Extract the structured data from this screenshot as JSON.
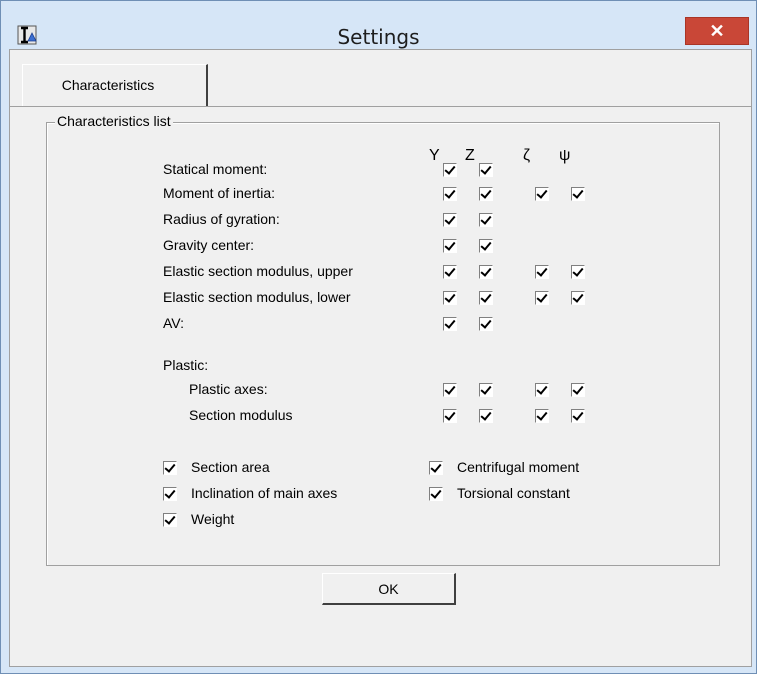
{
  "window": {
    "title": "Settings",
    "close_label": "✕"
  },
  "tabs": [
    {
      "label": "Characteristics"
    }
  ],
  "group": {
    "title": "Characteristics list"
  },
  "columns": [
    "Y",
    "Z",
    "ζ",
    "ψ"
  ],
  "rows": [
    {
      "label": "Statical moment:",
      "checks": [
        true,
        true,
        null,
        null
      ]
    },
    {
      "label": "Moment of inertia:",
      "checks": [
        true,
        true,
        true,
        true
      ]
    },
    {
      "label": "Radius of gyration:",
      "checks": [
        true,
        true,
        null,
        null
      ]
    },
    {
      "label": "Gravity center:",
      "checks": [
        true,
        true,
        null,
        null
      ]
    },
    {
      "label": "Elastic section modulus, upper",
      "checks": [
        true,
        true,
        true,
        true
      ]
    },
    {
      "label": "Elastic section modulus, lower",
      "checks": [
        true,
        true,
        true,
        true
      ]
    },
    {
      "label": "AV:",
      "checks": [
        true,
        true,
        null,
        null
      ]
    }
  ],
  "plastic": {
    "title": "Plastic:",
    "rows": [
      {
        "label": "Plastic axes:",
        "checks": [
          true,
          true,
          true,
          true
        ]
      },
      {
        "label": "Section modulus",
        "checks": [
          true,
          true,
          true,
          true
        ]
      }
    ]
  },
  "options_left": [
    {
      "label": "Section area",
      "checked": true
    },
    {
      "label": "Inclination of main axes",
      "checked": true
    },
    {
      "label": "Weight",
      "checked": true
    }
  ],
  "options_right": [
    {
      "label": "Centrifugal moment",
      "checked": true
    },
    {
      "label": "Torsional constant",
      "checked": true
    }
  ],
  "ok_label": "OK"
}
